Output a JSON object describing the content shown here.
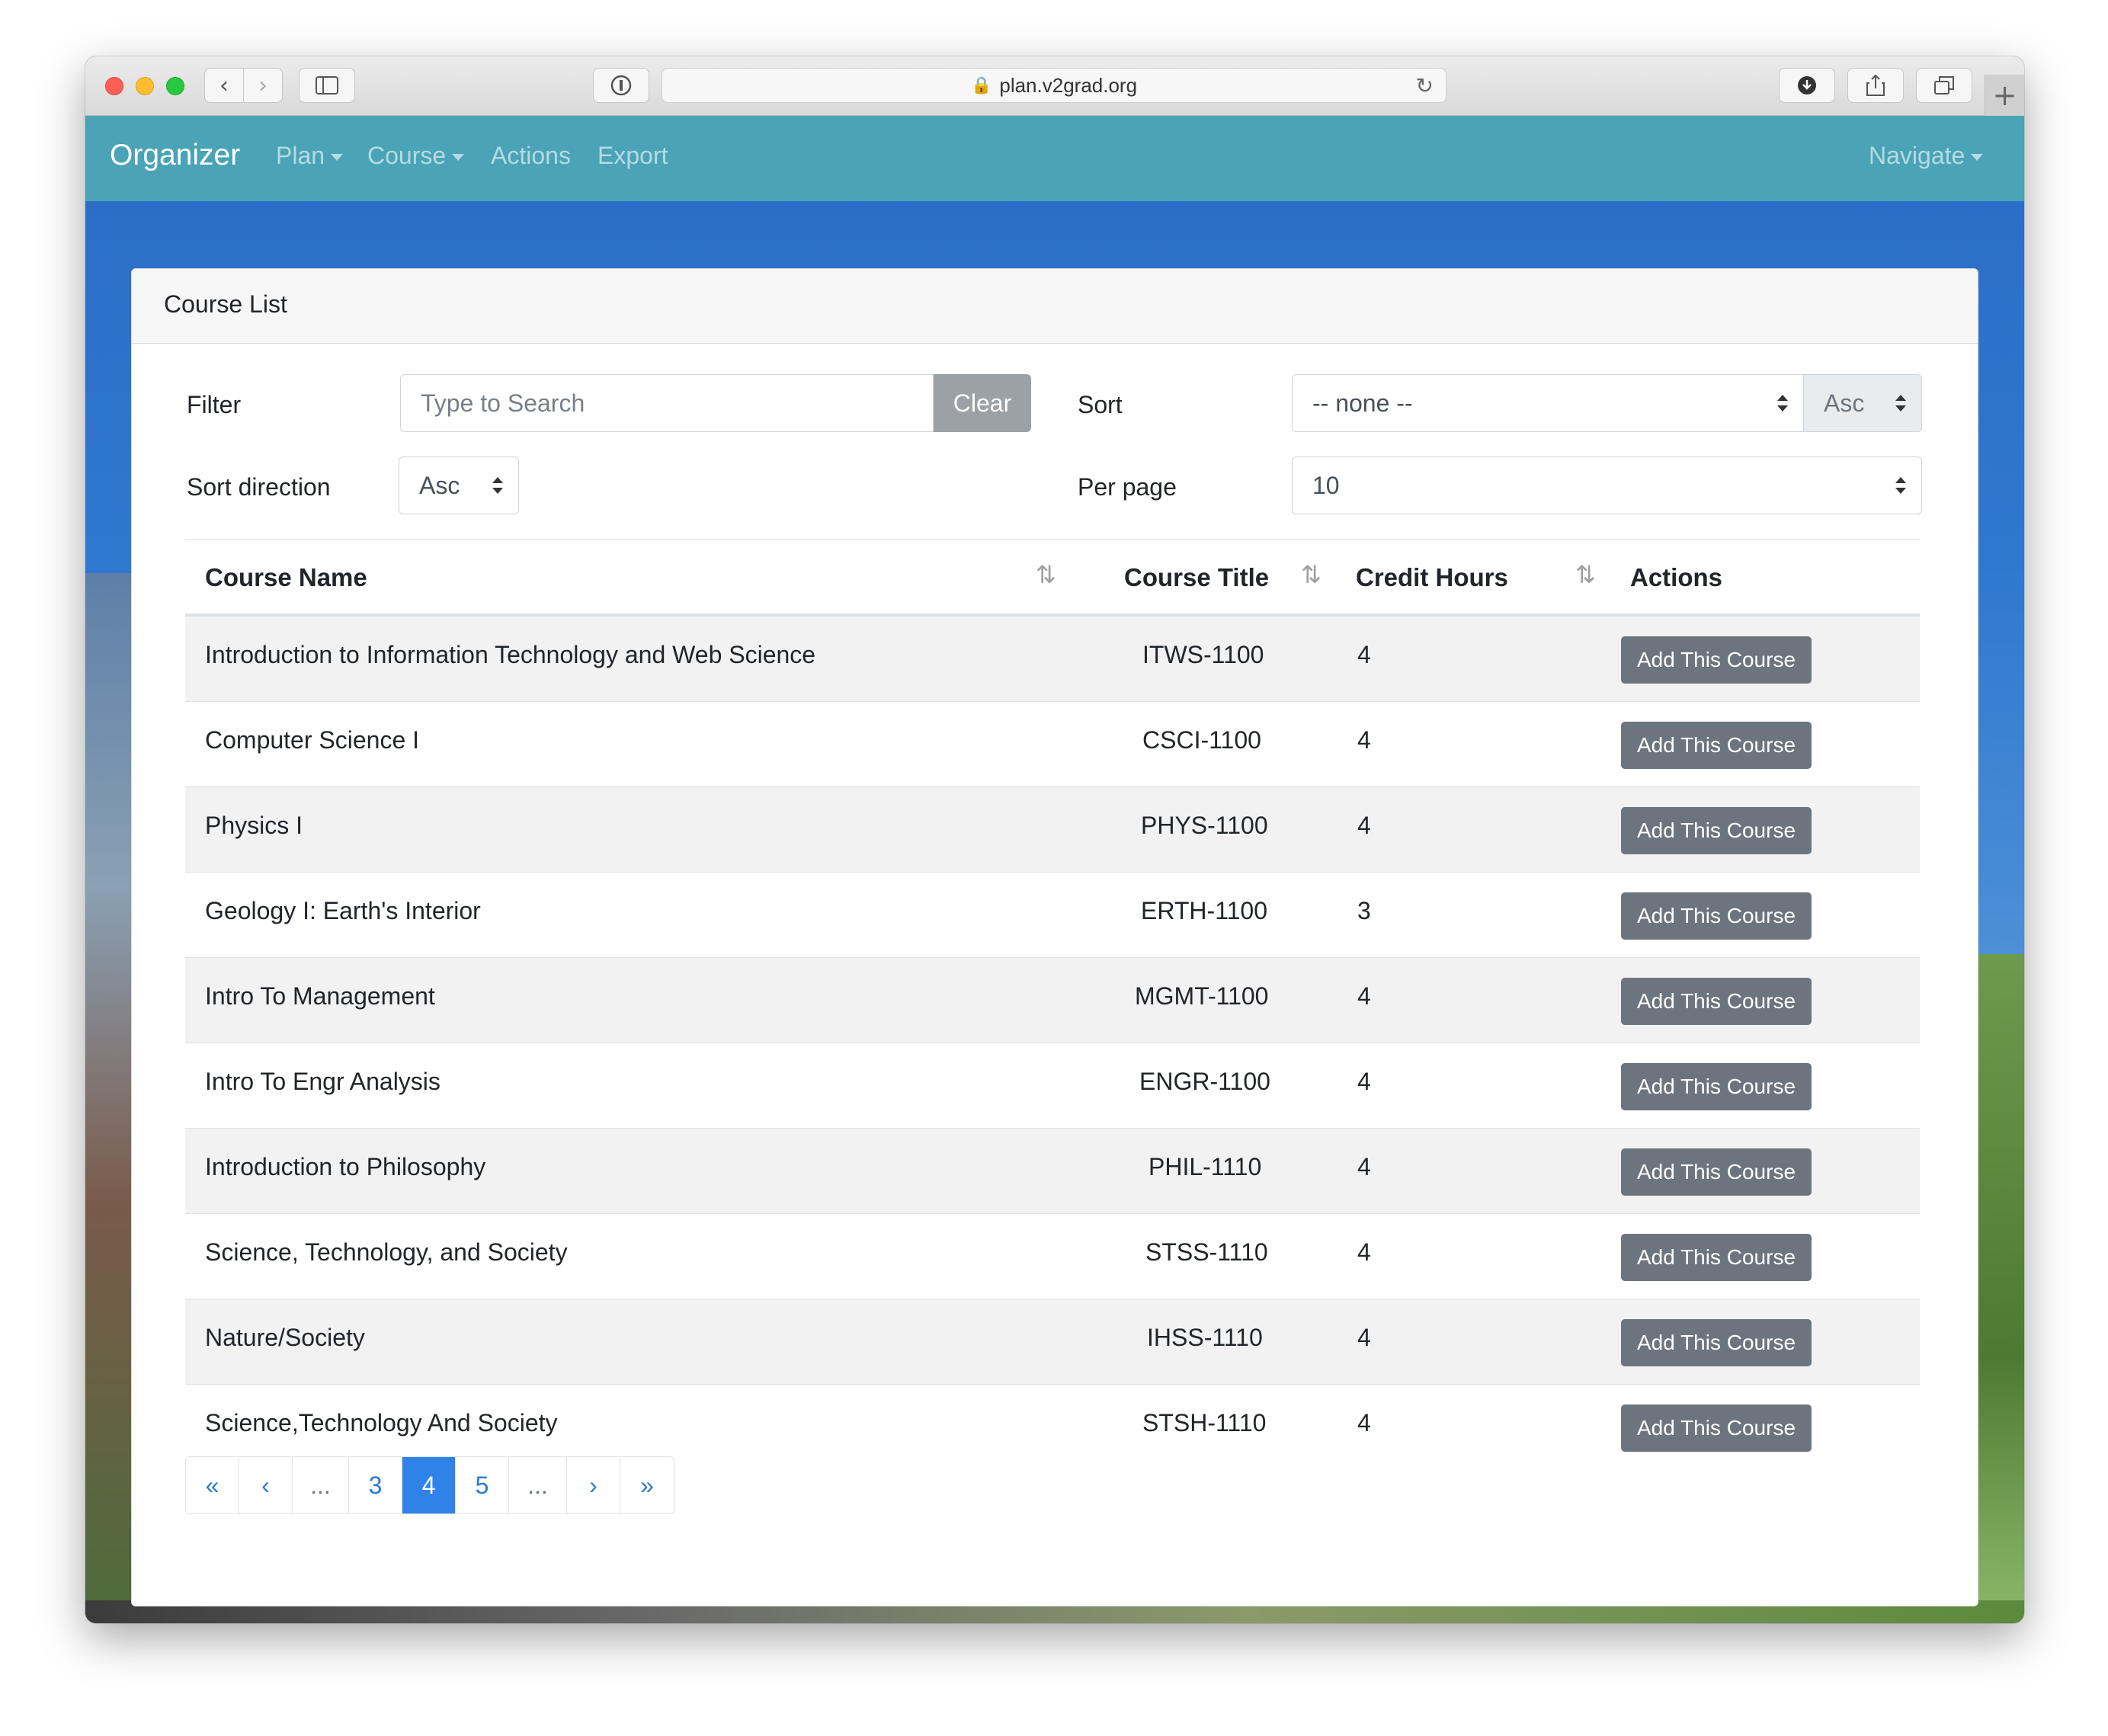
{
  "browser": {
    "url": "plan.v2grad.org"
  },
  "navbar": {
    "brand": "Organizer",
    "items": [
      {
        "label": "Plan",
        "dropdown": true
      },
      {
        "label": "Course",
        "dropdown": true
      },
      {
        "label": "Actions",
        "dropdown": false
      },
      {
        "label": "Export",
        "dropdown": false
      }
    ],
    "right": {
      "label": "Navigate",
      "dropdown": true
    },
    "color": "#4aa3b6"
  },
  "card": {
    "title": "Course List"
  },
  "controls": {
    "filter_label": "Filter",
    "search_placeholder": "Type to Search",
    "clear_label": "Clear",
    "sort_label": "Sort",
    "sort_value": "-- none --",
    "sort_dir_inline": "Asc",
    "sort_direction_label": "Sort direction",
    "sort_direction_value": "Asc",
    "per_page_label": "Per page",
    "per_page_value": "10"
  },
  "table": {
    "columns": [
      "Course Name",
      "Course Title",
      "Credit Hours",
      "Actions"
    ],
    "action_label": "Add This Course",
    "rows": [
      {
        "name": "Introduction to Information Technology and Web Science",
        "code": "ITWS-1100",
        "credits": "4"
      },
      {
        "name": "Computer Science I",
        "code": "CSCI-1100",
        "credits": "4"
      },
      {
        "name": "Physics I",
        "code": "PHYS-1100",
        "credits": "4"
      },
      {
        "name": "Geology I: Earth's Interior",
        "code": "ERTH-1100",
        "credits": "3"
      },
      {
        "name": "Intro To Management",
        "code": "MGMT-1100",
        "credits": "4"
      },
      {
        "name": "Intro To Engr Analysis",
        "code": "ENGR-1100",
        "credits": "4"
      },
      {
        "name": "Introduction to Philosophy",
        "code": "PHIL-1110",
        "credits": "4"
      },
      {
        "name": "Science, Technology, and Society",
        "code": "STSS-1110",
        "credits": "4"
      },
      {
        "name": "Nature/Society",
        "code": "IHSS-1110",
        "credits": "4"
      },
      {
        "name": "Science,Technology And Society",
        "code": "STSH-1110",
        "credits": "4"
      }
    ]
  },
  "pagination": {
    "first": "«",
    "prev": "‹",
    "ellipsis_left": "...",
    "pages": [
      "3",
      "4",
      "5"
    ],
    "current": "4",
    "ellipsis_right": "...",
    "next": "›",
    "last": "»",
    "active_color": "#2f82e8"
  }
}
